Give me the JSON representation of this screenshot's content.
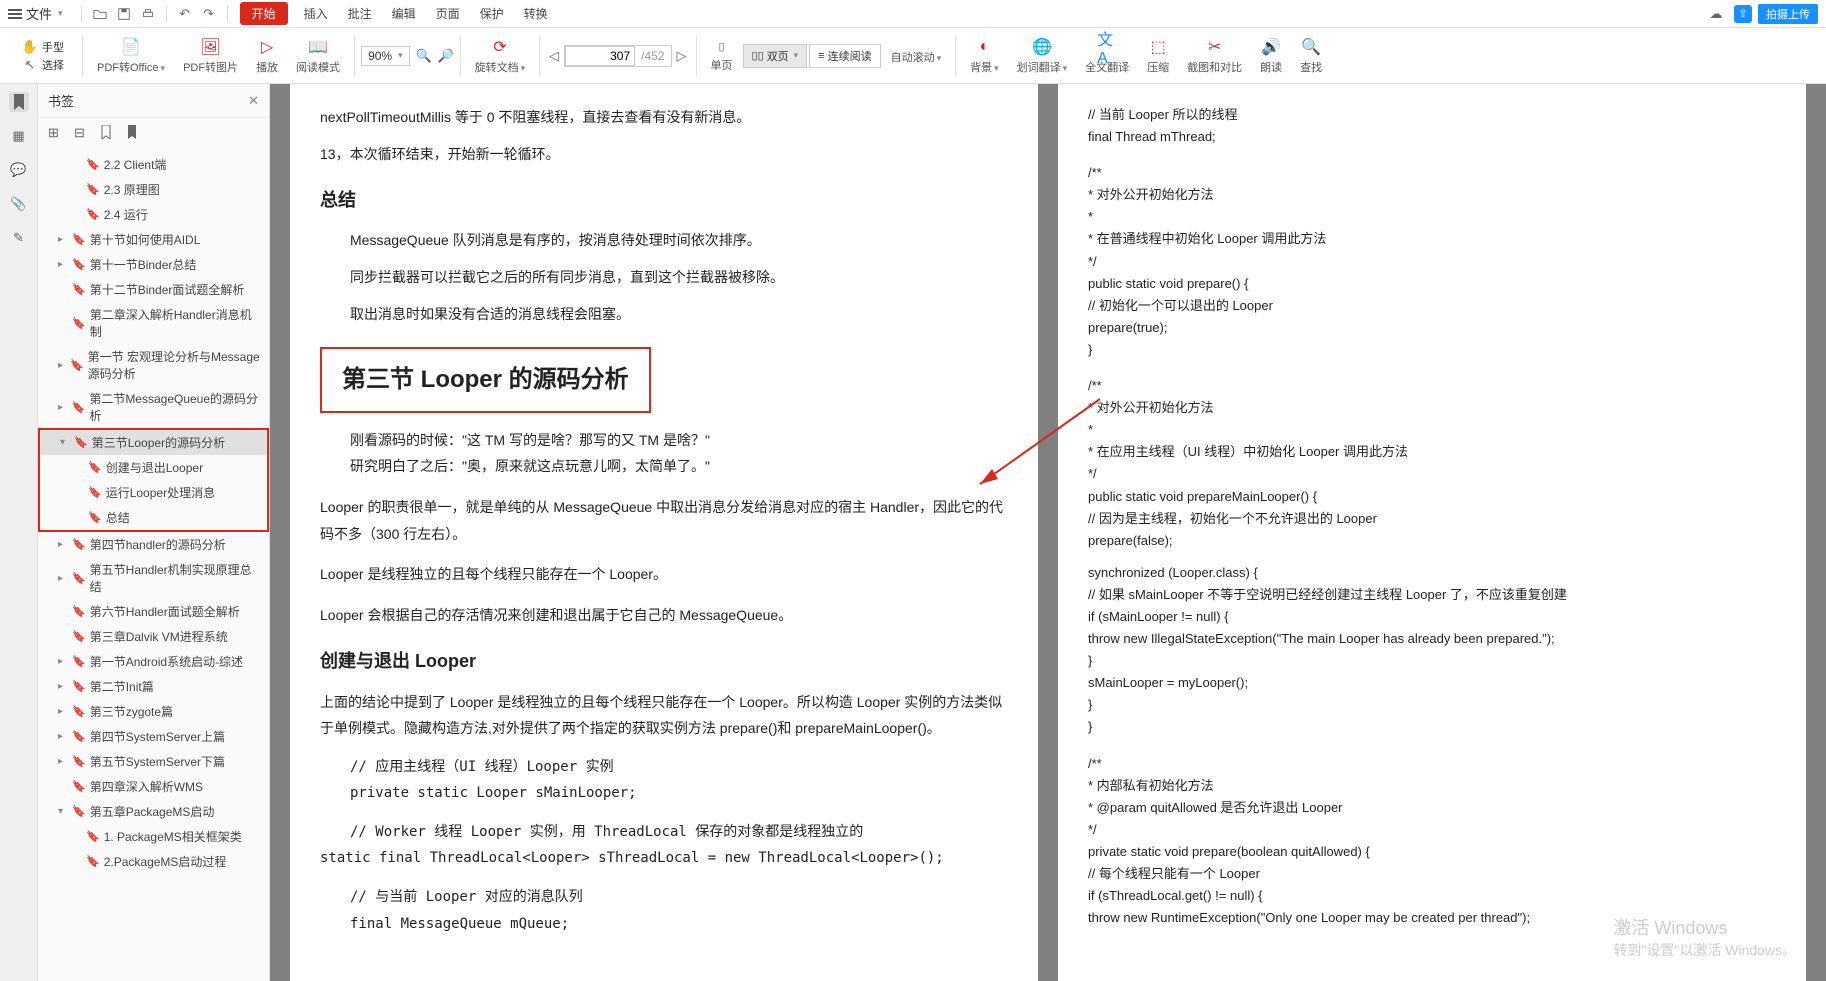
{
  "menu": {
    "file": "文件",
    "tabs": [
      "开始",
      "插入",
      "批注",
      "编辑",
      "页面",
      "保护",
      "转换"
    ]
  },
  "top_right": {
    "upload": "拍摄上传"
  },
  "ribbon": {
    "hand": "手型",
    "select": "选择",
    "pdf2office": "PDF转Office",
    "pdf2img": "PDF转图片",
    "play": "播放",
    "read": "阅读模式",
    "zoom": "90%",
    "rotate": "旋转文档",
    "page_current": "307",
    "page_total": "/452",
    "single": "单页",
    "double": "双页",
    "continuous": "连续阅读",
    "autoscroll": "自动滚动",
    "bg": "背景",
    "translate": "划词翻译",
    "fulltrans": "全文翻译",
    "compress": "压缩",
    "screenshot": "截图和对比",
    "readout": "朗读",
    "find": "查找"
  },
  "sidebar": {
    "title": "书签",
    "items": [
      {
        "lvl": "1",
        "txt": "2.2 Client端"
      },
      {
        "lvl": "1",
        "txt": "2.3 原理图"
      },
      {
        "lvl": "1",
        "txt": "2.4 运行"
      },
      {
        "lvl": "0",
        "arrow": "▸",
        "txt": "第十节如何使用AIDL"
      },
      {
        "lvl": "0",
        "arrow": "▸",
        "txt": "第十一节Binder总结"
      },
      {
        "lvl": "0",
        "txt": "第十二节Binder面试题全解析"
      },
      {
        "lvl": "0",
        "txt": "第二章深入解析Handler消息机制"
      },
      {
        "lvl": "0",
        "arrow": "▸",
        "txt": "第一节 宏观理论分析与Message源码分析"
      },
      {
        "lvl": "0",
        "arrow": "▸",
        "txt": "第二节MessageQueue的源码分析"
      },
      {
        "lvl": "0",
        "arrow": "▾",
        "txt": "第三节Looper的源码分析",
        "sel": true,
        "box": "top"
      },
      {
        "lvl": "1",
        "txt": "创建与退出Looper",
        "box": "mid"
      },
      {
        "lvl": "1",
        "txt": "运行Looper处理消息",
        "box": "mid"
      },
      {
        "lvl": "1",
        "txt": "总结",
        "box": "bot"
      },
      {
        "lvl": "0",
        "arrow": "▸",
        "txt": "第四节handler的源码分析"
      },
      {
        "lvl": "0",
        "arrow": "▸",
        "txt": "第五节Handler机制实现原理总结"
      },
      {
        "lvl": "0",
        "txt": "第六节Handler面试题全解析"
      },
      {
        "lvl": "0",
        "txt": "第三章Dalvik VM进程系统"
      },
      {
        "lvl": "0",
        "arrow": "▸",
        "txt": "第一节Android系统启动-综述"
      },
      {
        "lvl": "0",
        "arrow": "▸",
        "txt": "第二节Init篇"
      },
      {
        "lvl": "0",
        "arrow": "▸",
        "txt": "第三节zygote篇"
      },
      {
        "lvl": "0",
        "arrow": "▸",
        "txt": "第四节SystemServer上篇"
      },
      {
        "lvl": "0",
        "arrow": "▸",
        "txt": "第五节SystemServer下篇"
      },
      {
        "lvl": "0",
        "txt": "第四章深入解析WMS"
      },
      {
        "lvl": "0",
        "arrow": "▾",
        "txt": "第五章PackageMS启动"
      },
      {
        "lvl": "1",
        "txt": "1. PackageMS相关框架类"
      },
      {
        "lvl": "1",
        "txt": "2.PackageMS启动过程"
      }
    ]
  },
  "page_left": {
    "line1": "nextPollTimeoutMillis 等于 0 不阻塞线程，直接去查看有没有新消息。",
    "line2": "13，本次循环结束，开始新一轮循环。",
    "h_summary": "总结",
    "sum1": "MessageQueue 队列消息是有序的，按消息待处理时间依次排序。",
    "sum2": "同步拦截器可以拦截它之后的所有同步消息，直到这个拦截器被移除。",
    "sum3": "取出消息时如果没有合适的消息线程会阻塞。",
    "h_title": "第三节 Looper 的源码分析",
    "quote1": "刚看源码的时候：\"这 TM 写的是啥？那写的又 TM 是啥？\"",
    "quote2": "研究明白了之后：\"奥，原来就这点玩意儿啊，太简单了。\"",
    "p1": "Looper 的职责很单一，就是单纯的从 MessageQueue 中取出消息分发给消息对应的宿主 Handler，因此它的代码不多（300 行左右）。",
    "p2": "Looper 是线程独立的且每个线程只能存在一个 Looper。",
    "p3": "Looper 会根据自己的存活情况来创建和退出属于它自己的 MessageQueue。",
    "h_create": "创建与退出 Looper",
    "p4": "上面的结论中提到了 Looper 是线程独立的且每个线程只能存在一个 Looper。所以构造 Looper 实例的方法类似于单例模式。隐藏构造方法,对外提供了两个指定的获取实例方法 prepare()和 prepareMainLooper()。",
    "c1": "// 应用主线程（UI 线程）Looper 实例",
    "c2": "private static Looper sMainLooper;",
    "c3": "// Worker 线程 Looper 实例，用 ThreadLocal 保存的对象都是线程独立的",
    "c4": "static final ThreadLocal<Looper> sThreadLocal = new ThreadLocal<Looper>();",
    "c5": "// 与当前 Looper 对应的消息队列",
    "c6": "final MessageQueue mQueue;"
  },
  "page_right": {
    "r1": "// 当前 Looper 所以的线程",
    "r2": "final Thread mThread;",
    "r3": "/**",
    "r4": " * 对外公开初始化方法",
    "r5": " *",
    "r6": " * 在普通线程中初始化 Looper 调用此方法",
    "r7": " */",
    "r8": "public static void prepare() {",
    "r9": "    // 初始化一个可以退出的 Looper",
    "r10": "    prepare(true);",
    "r11": "}",
    "r12": "/**",
    "r13": " * 对外公开初始化方法",
    "r14": " *",
    "r15": " * 在应用主线程（UI 线程）中初始化 Looper 调用此方法",
    "r16": " */",
    "r17": "public static void prepareMainLooper() {",
    "r18": "    // 因为是主线程，初始化一个不允许退出的 Looper",
    "r19": "    prepare(false);",
    "r20": "    synchronized (Looper.class) {",
    "r21": "        // 如果 sMainLooper 不等于空说明已经经创建过主线程 Looper 了，不应该重复创建",
    "r22": "        if (sMainLooper != null) {",
    "r23": "            throw new IllegalStateException(\"The main Looper has already been prepared.\");",
    "r24": "        }",
    "r25": "        sMainLooper = myLooper();",
    "r26": "    }",
    "r27": "}",
    "r28": "/**",
    "r29": " * 内部私有初始化方法",
    "r30": " * @param quitAllowed 是否允许退出 Looper",
    "r31": " */",
    "r32": "private static void prepare(boolean quitAllowed) {",
    "r33": "    // 每个线程只能有一个 Looper",
    "r34": "    if (sThreadLocal.get() != null) {",
    "r35": "        throw new RuntimeException(\"Only one Looper may be created per thread\");"
  },
  "watermark": {
    "l1": "激活 Windows",
    "l2": "转到\"设置\"以激活 Windows。"
  }
}
